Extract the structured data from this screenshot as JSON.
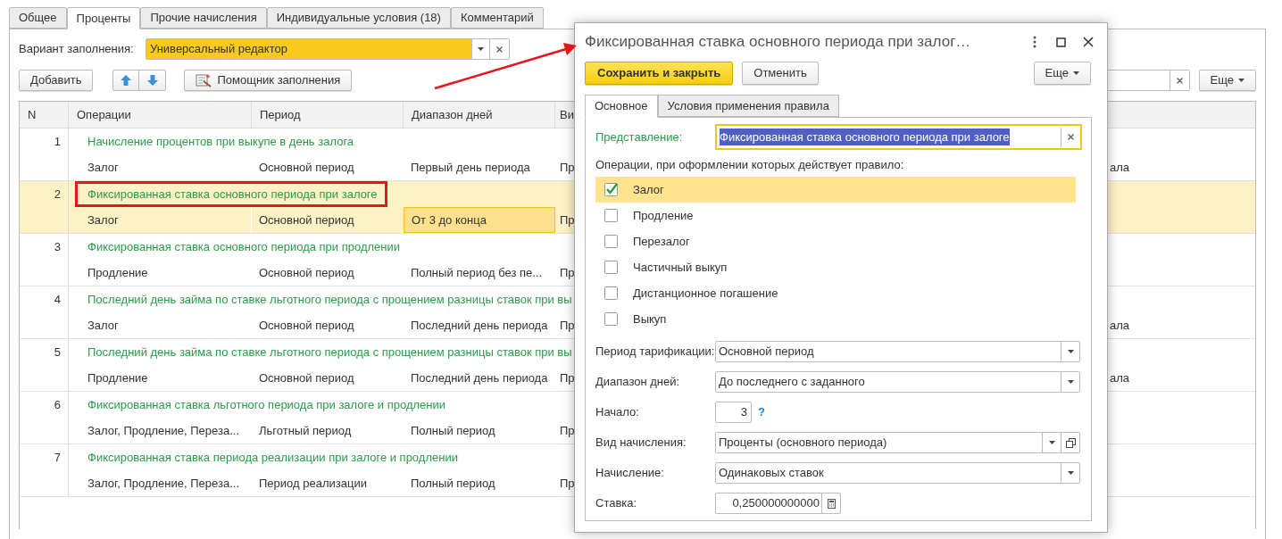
{
  "tabs": [
    {
      "label": "Общее",
      "selected": false
    },
    {
      "label": "Проценты",
      "selected": true
    },
    {
      "label": "Прочие начисления",
      "selected": false
    },
    {
      "label": "Индивидуальные условия (18)",
      "selected": false
    },
    {
      "label": "Комментарий",
      "selected": false
    }
  ],
  "fill_variant": {
    "label": "Вариант заполнения:",
    "value": "Универсальный редактор"
  },
  "toolbar": {
    "add": "Добавить",
    "helper": "Помощник заполнения",
    "more": "Еще"
  },
  "table": {
    "columns": [
      "N",
      "Операции",
      "Период",
      "Диапазон дней",
      "Ви"
    ],
    "rows": [
      {
        "n": "1",
        "title": "Начисление процентов при выкупе в день залога",
        "operations": "Залог",
        "period": "Основной период",
        "range": "Первый день периода",
        "column_5": "Пр",
        "column_6": "ала",
        "selected": false,
        "range_focused": false
      },
      {
        "n": "2",
        "title": "Фиксированная ставка основного периода при залоге",
        "operations": "Залог",
        "period": "Основной период",
        "range": "От 3 до конца",
        "column_5": "Пр",
        "selected": true,
        "range_focused": true,
        "callout": true
      },
      {
        "n": "3",
        "title": "Фиксированная ставка основного периода при продлении",
        "operations": "Продление",
        "period": "Основной период",
        "range": "Полный период без пе...",
        "column_5": "Пр",
        "selected": false,
        "range_focused": false
      },
      {
        "n": "4",
        "title": "Последний день займа по ставке льготного периода с прощением разницы ставок при вы",
        "operations": "Залог",
        "period": "Основной период",
        "range": "Последний день периода",
        "column_5": "Пр",
        "column_6": "ала",
        "selected": false,
        "range_focused": false
      },
      {
        "n": "5",
        "title": "Последний день займа по ставке льготного периода с прощением разницы ставок при вы",
        "operations": "Продление",
        "period": "Основной период",
        "range": "Последний день периода",
        "column_5": "Пр",
        "column_6": "ала",
        "selected": false,
        "range_focused": false
      },
      {
        "n": "6",
        "title": "Фиксированная ставка льготного периода при залоге и продлении",
        "operations": "Залог, Продление, Переза...",
        "period": "Льготный период",
        "range": "Полный период",
        "column_5": "Пр",
        "selected": false,
        "range_focused": false
      },
      {
        "n": "7",
        "title": "Фиксированная ставка периода реализации при залоге и продлении",
        "operations": "Залог, Продление, Переза...",
        "period": "Период реализации",
        "range": "Полный период",
        "column_5": "Пр",
        "selected": false,
        "range_focused": false
      }
    ]
  },
  "dialog": {
    "title": "Фиксированная ставка основного периода при залог…",
    "save": "Сохранить и закрыть",
    "cancel": "Отменить",
    "more": "Еще",
    "tabs": [
      {
        "label": "Основное",
        "selected": true
      },
      {
        "label": "Условия применения правила",
        "selected": false
      }
    ],
    "presentation": {
      "label": "Представление:",
      "value": "Фиксированная ставка основного периода при залоге"
    },
    "operations_label": "Операции, при оформлении которых действует правило:",
    "operations": [
      {
        "label": "Залог",
        "checked": true,
        "selected": true
      },
      {
        "label": "Продление",
        "checked": false,
        "selected": false
      },
      {
        "label": "Перезалог",
        "checked": false,
        "selected": false
      },
      {
        "label": "Частичный выкуп",
        "checked": false,
        "selected": false
      },
      {
        "label": "Дистанционное погашение",
        "checked": false,
        "selected": false
      },
      {
        "label": "Выкуп",
        "checked": false,
        "selected": false
      }
    ],
    "fields": [
      {
        "kind": "select",
        "label": "Период тарификации:",
        "value": "Основной период"
      },
      {
        "kind": "select",
        "label": "Диапазон дней:",
        "value": "До последнего с заданного"
      },
      {
        "kind": "number",
        "label": "Начало:",
        "value": "3",
        "hint": "?"
      },
      {
        "kind": "select_open",
        "label": "Вид начисления:",
        "value": "Проценты (основного периода)"
      },
      {
        "kind": "select",
        "label": "Начисление:",
        "value": "Одинаковых ставок"
      },
      {
        "kind": "calc",
        "label": "Ставка:",
        "value": "0,250000000000"
      }
    ]
  }
}
